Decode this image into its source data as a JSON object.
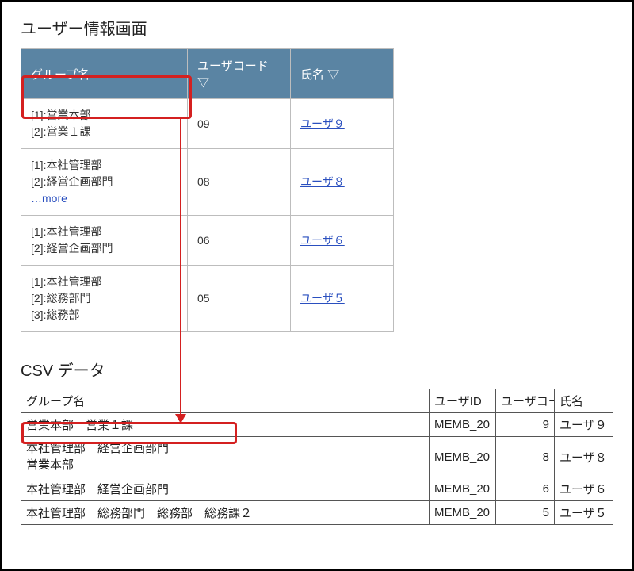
{
  "sections": {
    "top_title": "ユーザー情報画面",
    "csv_title": "CSV データ"
  },
  "top_table": {
    "headers": {
      "group": "グループ名",
      "user_code": "ユーザコード ▽",
      "name": "氏名 ▽"
    },
    "rows": [
      {
        "group_line1": "[1]:営業本部",
        "group_line2": "[2]:営業１課",
        "group_line3": "",
        "more": "",
        "code": "09",
        "name": "ユーザ９"
      },
      {
        "group_line1": "[1]:本社管理部",
        "group_line2": "[2]:経営企画部門",
        "group_line3": "",
        "more": "…more",
        "code": "08",
        "name": "ユーザ８"
      },
      {
        "group_line1": "[1]:本社管理部",
        "group_line2": "[2]:経営企画部門",
        "group_line3": "",
        "more": "",
        "code": "06",
        "name": "ユーザ６"
      },
      {
        "group_line1": "[1]:本社管理部",
        "group_line2": "[2]:総務部門",
        "group_line3": "[3]:総務部",
        "more": "",
        "code": "05",
        "name": "ユーザ５"
      }
    ]
  },
  "csv_table": {
    "headers": {
      "group": "グループ名",
      "user_id": "ユーザID",
      "user_code": "ユーザコー",
      "name": "氏名"
    },
    "rows": [
      {
        "group": "営業本部　営業１課",
        "uid": "MEMB_20",
        "ucode": "9",
        "uname": "ユーザ９"
      },
      {
        "group": "本社管理部　経営企画部門\n営業本部",
        "uid": "MEMB_20",
        "ucode": "8",
        "uname": "ユーザ８"
      },
      {
        "group": "本社管理部　経営企画部門",
        "uid": "MEMB_20",
        "ucode": "6",
        "uname": "ユーザ６"
      },
      {
        "group": "本社管理部　総務部門　総務部　総務課２",
        "uid": "MEMB_20",
        "ucode": "5",
        "uname": "ユーザ５"
      }
    ]
  }
}
